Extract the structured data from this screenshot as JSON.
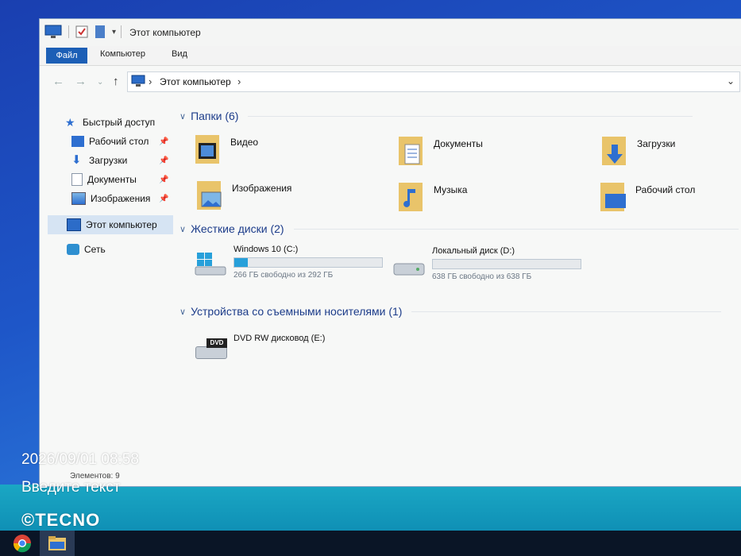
{
  "window": {
    "title": "Этот компьютер"
  },
  "ribbon": {
    "tabs": [
      "Файл",
      "Компьютер",
      "Вид"
    ]
  },
  "address": {
    "crumb": "Этот компьютер",
    "separator": "›"
  },
  "sidebar": {
    "quick_access": "Быстрый доступ",
    "items": [
      {
        "label": "Рабочий стол",
        "pinned": true
      },
      {
        "label": "Загрузки",
        "pinned": true
      },
      {
        "label": "Документы",
        "pinned": true
      },
      {
        "label": "Изображения",
        "pinned": true
      }
    ],
    "this_pc": "Этот компьютер",
    "network": "Сеть"
  },
  "groups": {
    "folders": "Папки (6)",
    "drives": "Жесткие диски (2)",
    "removable": "Устройства со съемными носителями (1)"
  },
  "folders": [
    {
      "label": "Видео",
      "icon": "video-folder-icon"
    },
    {
      "label": "Документы",
      "icon": "documents-folder-icon"
    },
    {
      "label": "Загрузки",
      "icon": "downloads-folder-icon"
    },
    {
      "label": "Изображения",
      "icon": "pictures-folder-icon"
    },
    {
      "label": "Музыка",
      "icon": "music-folder-icon"
    },
    {
      "label": "Рабочий стол",
      "icon": "desktop-folder-icon"
    }
  ],
  "drives": [
    {
      "name": "Windows 10 (C:)",
      "free": "266 ГБ свободно из 292 ГБ",
      "used_fraction": 0.09
    },
    {
      "name": "Локальный диск (D:)",
      "free": "638 ГБ свободно из 638 ГБ",
      "used_fraction": 0.0
    }
  ],
  "removable": [
    {
      "name": "DVD RW дисковод (E:)",
      "badge": "DVD"
    }
  ],
  "status": {
    "items": "Элементов: 9"
  },
  "overlay": {
    "datetime": "2026/09/01 08:58",
    "text": "Введите текст",
    "brand": "©TECNO"
  },
  "colors": {
    "accent": "#1c5fb6",
    "drive_fill": "#27a0da",
    "group_header": "#1c3c8a"
  }
}
